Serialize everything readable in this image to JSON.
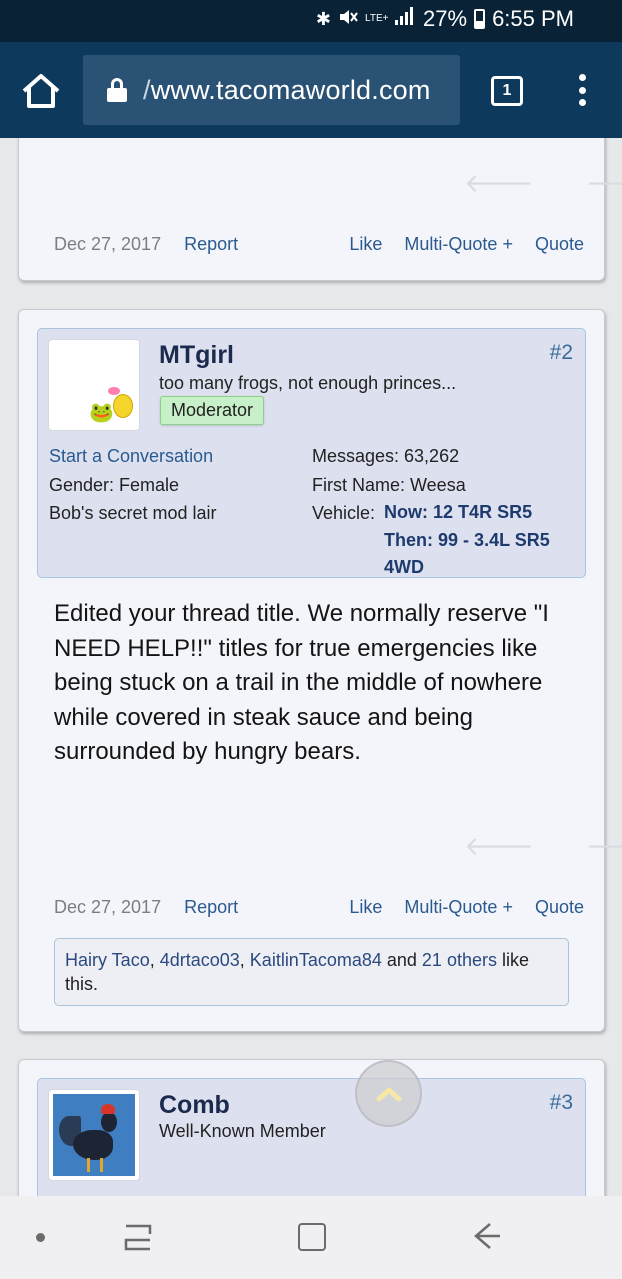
{
  "status_bar": {
    "signal_label": "LTE+",
    "battery": "27%",
    "time": "6:55 PM"
  },
  "browser": {
    "url_prefix": "/",
    "url": "www.tacomaworld.com",
    "tab_count": "1"
  },
  "post1": {
    "date": "Dec 27, 2017",
    "report": "Report",
    "like": "Like",
    "multiquote": "Multi-Quote +",
    "quote": "Quote"
  },
  "post2": {
    "username": "MTgirl",
    "user_title": "too many frogs, not enough princes...",
    "badge": "Moderator",
    "post_number": "#2",
    "start_conversation": "Start a Conversation",
    "gender": "Gender:  Female",
    "location": "Bob's secret mod lair",
    "messages": "Messages:  63,262",
    "first_name": "First Name:  Weesa",
    "vehicle_label": "Vehicle:",
    "vehicle_now": "Now: 12 T4R SR5",
    "vehicle_then": "Then: 99 - 3.4L SR5 4WD",
    "message": "Edited your thread title. We normally reserve \"I NEED HELP!!\" titles for true emergencies like being stuck on a trail in the middle of nowhere while covered in steak sauce and being surrounded by hungry bears.",
    "date": "Dec 27, 2017",
    "report": "Report",
    "like": "Like",
    "multiquote": "Multi-Quote +",
    "quote": "Quote",
    "likes": {
      "user1": "Hairy Taco",
      "sep1": ", ",
      "user2": "4drtaco03",
      "sep2": ", ",
      "user3": "KaitlinTacoma84",
      "and": " and ",
      "others": "21 others",
      "suffix": " like this."
    }
  },
  "post3": {
    "username": "Comb",
    "user_title": "Well-Known Member",
    "post_number": "#3"
  },
  "colors": {
    "header_bg": "#0d3a5c",
    "status_bg": "#0a2236",
    "link": "#2a5a8f",
    "moderator_badge": "#c8f0c8"
  },
  "icons": [
    "bluetooth-icon",
    "mute-icon",
    "signal-icon",
    "battery-icon",
    "home-icon",
    "lock-icon",
    "tabs-icon",
    "overflow-menu-icon",
    "prev-arrow-icon",
    "next-arrow-icon",
    "scroll-top-icon",
    "recent-apps-icon",
    "home-nav-icon",
    "back-icon"
  ]
}
